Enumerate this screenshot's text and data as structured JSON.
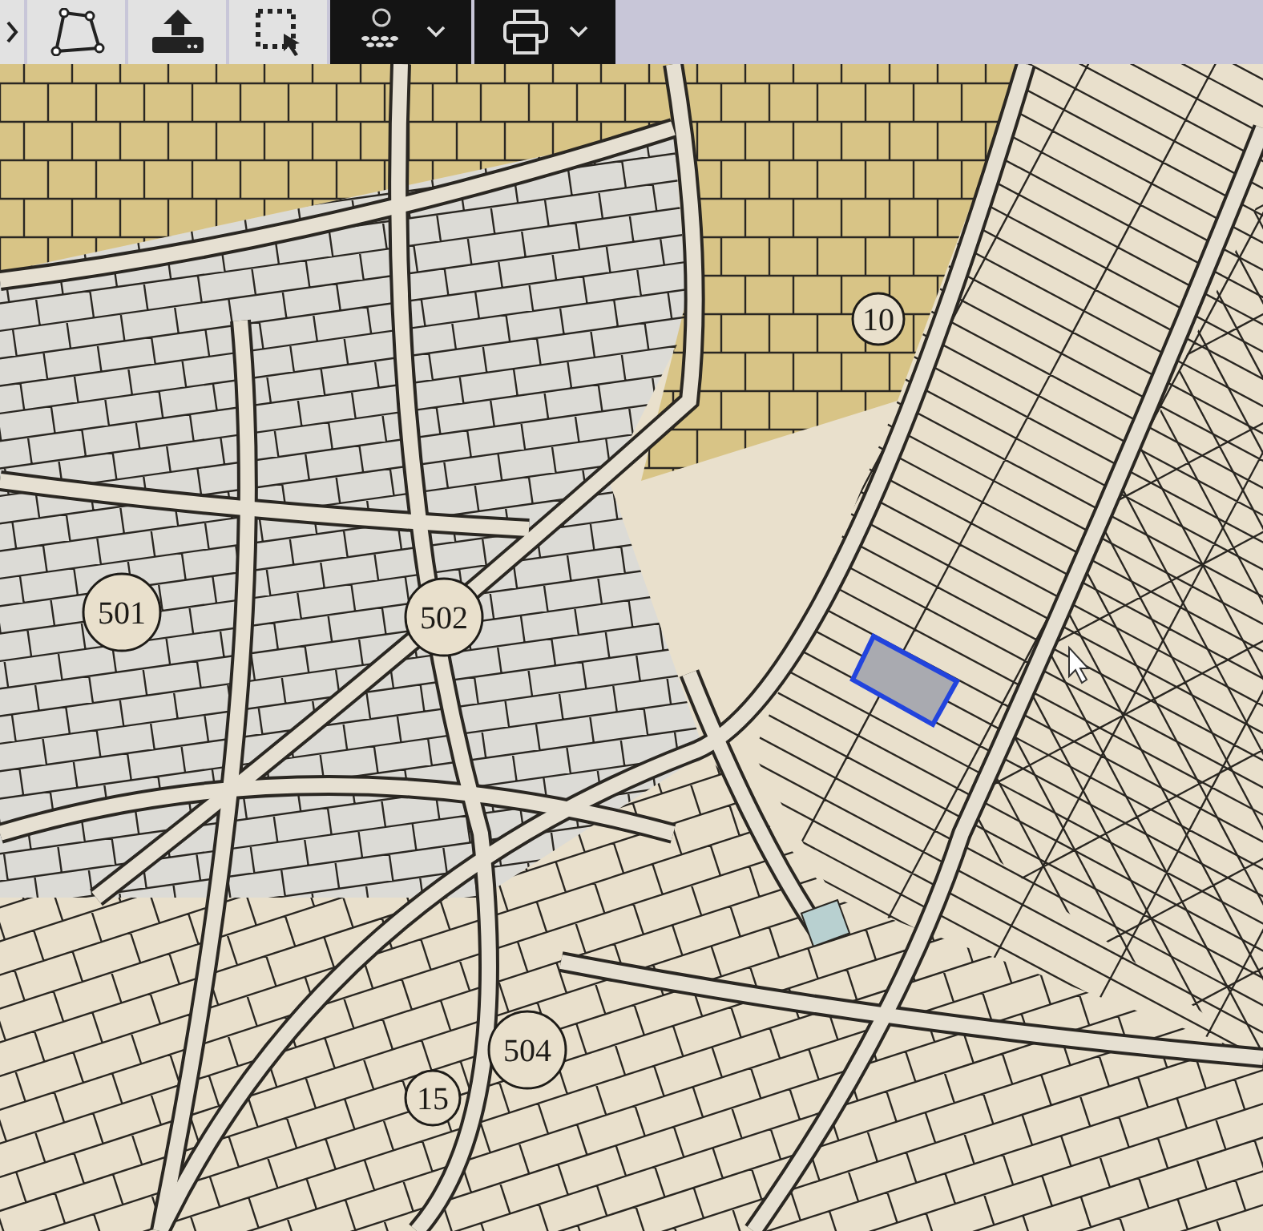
{
  "map": {
    "block_labels": [
      {
        "text": "501"
      },
      {
        "text": "502"
      },
      {
        "text": "504"
      },
      {
        "text": "15"
      },
      {
        "text": "10"
      }
    ]
  }
}
